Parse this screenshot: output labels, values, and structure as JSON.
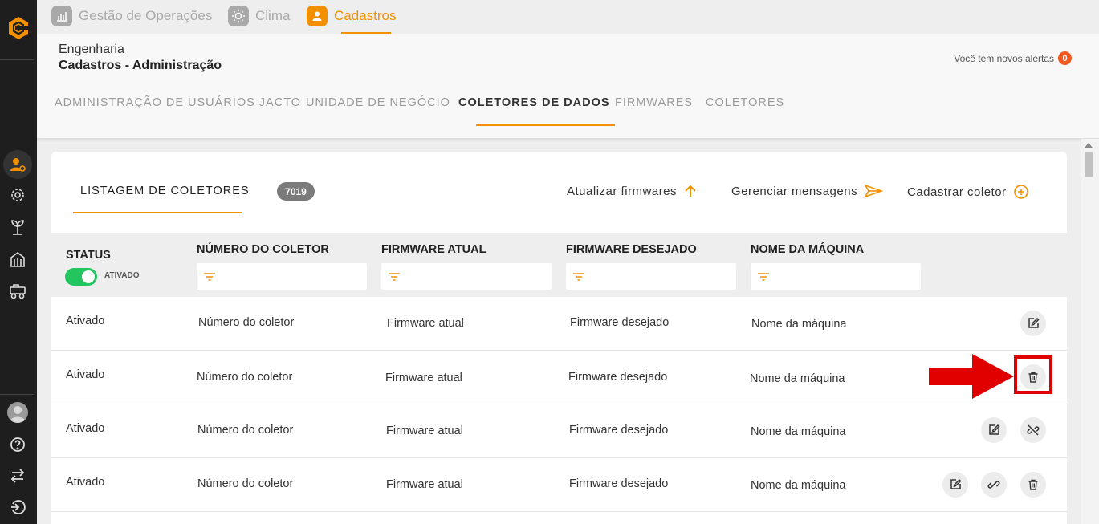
{
  "topnav": {
    "tabs": [
      {
        "label": "Gestão de Operações",
        "icon": "operations-icon"
      },
      {
        "label": "Clima",
        "icon": "sun-icon"
      },
      {
        "label": "Cadastros",
        "icon": "user-icon",
        "active": true
      }
    ]
  },
  "header": {
    "breadcrumb": "Engenharia",
    "title": "Cadastros - Administração",
    "alerts_text": "Você tem novos alertas",
    "alerts_count": "0"
  },
  "subtabs": [
    {
      "label": "ADMINISTRAÇÃO DE USUÁRIOS JACTO"
    },
    {
      "label": "UNIDADE DE NEGÓCIO"
    },
    {
      "label": "COLETORES DE DADOS",
      "active": true
    },
    {
      "label": "FIRMWARES"
    },
    {
      "label": "COLETORES"
    }
  ],
  "card": {
    "title": "LISTAGEM DE COLETORES",
    "count": "7019",
    "actions": {
      "update_firmwares": "Atualizar firmwares",
      "manage_messages": "Gerenciar mensagens",
      "register_collector": "Cadastrar coletor"
    }
  },
  "table": {
    "columns": {
      "status": "STATUS",
      "status_toggle_label": "ATIVADO",
      "collector_number": "NÚMERO DO COLETOR",
      "current_firmware": "FIRMWARE ATUAL",
      "desired_firmware": "FIRMWARE DESEJADO",
      "machine_name": "NOME DA MÁQUINA"
    },
    "rows": [
      {
        "status": "Ativado",
        "collector_number": "Número do coletor",
        "current_firmware": "Firmware atual",
        "desired_firmware": "Firmware desejado",
        "machine_name": "Nome da máquina"
      },
      {
        "status": "Ativado",
        "collector_number": "Número do coletor",
        "current_firmware": "Firmware atual",
        "desired_firmware": "Firmware desejado",
        "machine_name": "Nome da máquina"
      },
      {
        "status": "Ativado",
        "collector_number": "Número do coletor",
        "current_firmware": "Firmware atual",
        "desired_firmware": "Firmware desejado",
        "machine_name": "Nome da máquina"
      },
      {
        "status": "Ativado",
        "collector_number": "Número do coletor",
        "current_firmware": "Firmware atual",
        "desired_firmware": "Firmware desejado",
        "machine_name": "Nome da máquina"
      }
    ]
  },
  "colors": {
    "accent": "#f39000",
    "sidebar": "#1e1e1e",
    "toggle_on": "#22c55e",
    "annotation": "#e00000"
  }
}
